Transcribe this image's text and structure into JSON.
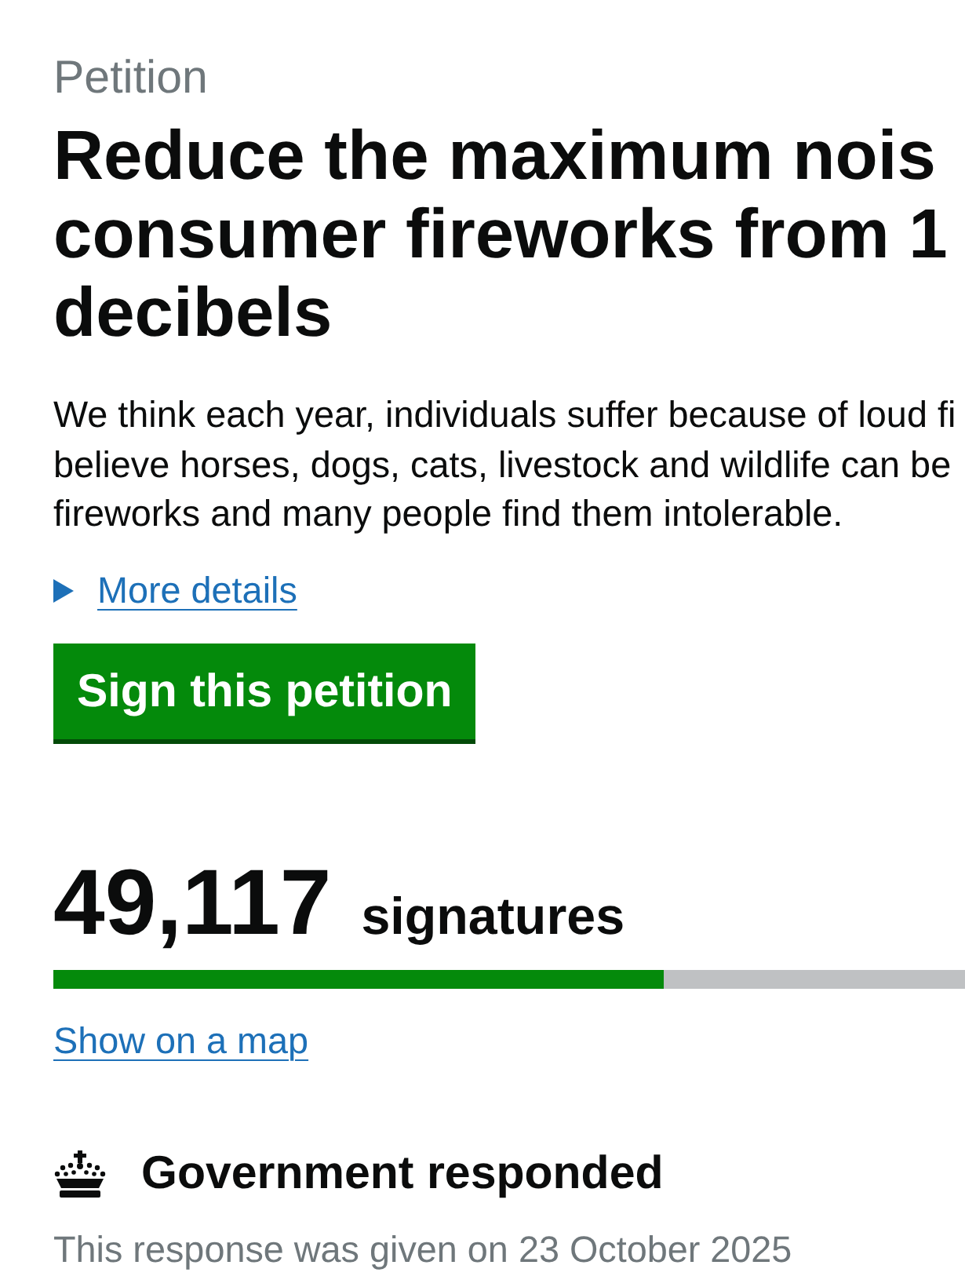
{
  "petition": {
    "caption": "Petition",
    "title_lines": [
      "Reduce the maximum nois",
      "consumer fireworks from 1",
      "decibels"
    ],
    "summary_lines": [
      "We think each year, individuals suffer because of loud fi",
      "believe horses, dogs, cats, livestock and wildlife can be",
      "fireworks and many people find them intolerable."
    ],
    "more_details": {
      "label": "More details",
      "expanded": false
    },
    "sign_button": "Sign this petition"
  },
  "signatures": {
    "count": "49,117",
    "label": "signatures",
    "level": 0.67,
    "map_link": "Show on a map"
  },
  "response": {
    "heading": "Government responded",
    "date_note": "This response was given on 23 October 2025"
  }
}
